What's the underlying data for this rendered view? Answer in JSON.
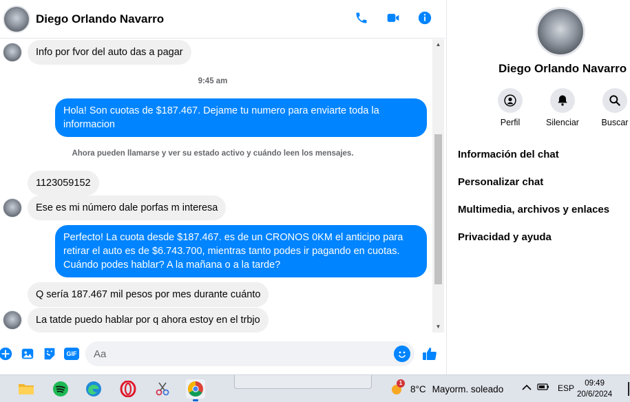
{
  "header": {
    "contact_name": "Diego Orlando Navarro",
    "actions": [
      "phone-icon",
      "video-call-icon",
      "info-icon"
    ]
  },
  "messages": {
    "m1": "Info por fvor del auto das a pagar",
    "timestamp": "9:45 am",
    "m2": "Hola! Son cuotas de $187.467. Dejame tu numero para enviarte toda la informacion",
    "system_note": "Ahora pueden llamarse y ver su estado activo y cuándo leen los mensajes.",
    "m3": "1123059152",
    "m4": "Ese es mi número dale porfas m interesa",
    "m5": "Perfecto! La cuota desde $187.467. es de un CRONOS 0KM el anticipo para retirar el auto es de $6.743.700, mientras tanto podes ir pagando en cuotas. Cuándo podes hablar? A la mañana o a la tarde?",
    "m6": "Q sería 187.467 mil pesos por mes durante cuánto",
    "m7": "La tatde puedo hablar por q ahora estoy en el trbjo"
  },
  "composer": {
    "placeholder": "Aa",
    "icons": [
      "plus-icon",
      "image-icon",
      "sticker-icon",
      "gif-icon",
      "emoji-icon",
      "like-icon"
    ],
    "gif_label": "GIF"
  },
  "side_panel": {
    "name": "Diego Orlando Navarro",
    "actions": [
      {
        "label": "Perfil",
        "icon": "profile-icon"
      },
      {
        "label": "Silenciar",
        "icon": "bell-icon"
      },
      {
        "label": "Buscar",
        "icon": "search-icon"
      }
    ],
    "menu": [
      "Información del chat",
      "Personalizar chat",
      "Multimedia, archivos y enlaces",
      "Privacidad y ayuda"
    ]
  },
  "taskbar": {
    "weather_badge": "1",
    "temperature": "8°C",
    "weather_text": "Mayorm. soleado",
    "language": "ESP",
    "time": "09:49",
    "date": "20/6/2024"
  },
  "colors": {
    "outgoing_bubble": "#0084ff",
    "incoming_bubble": "#f0f0f0",
    "accent": "#0084ff"
  }
}
